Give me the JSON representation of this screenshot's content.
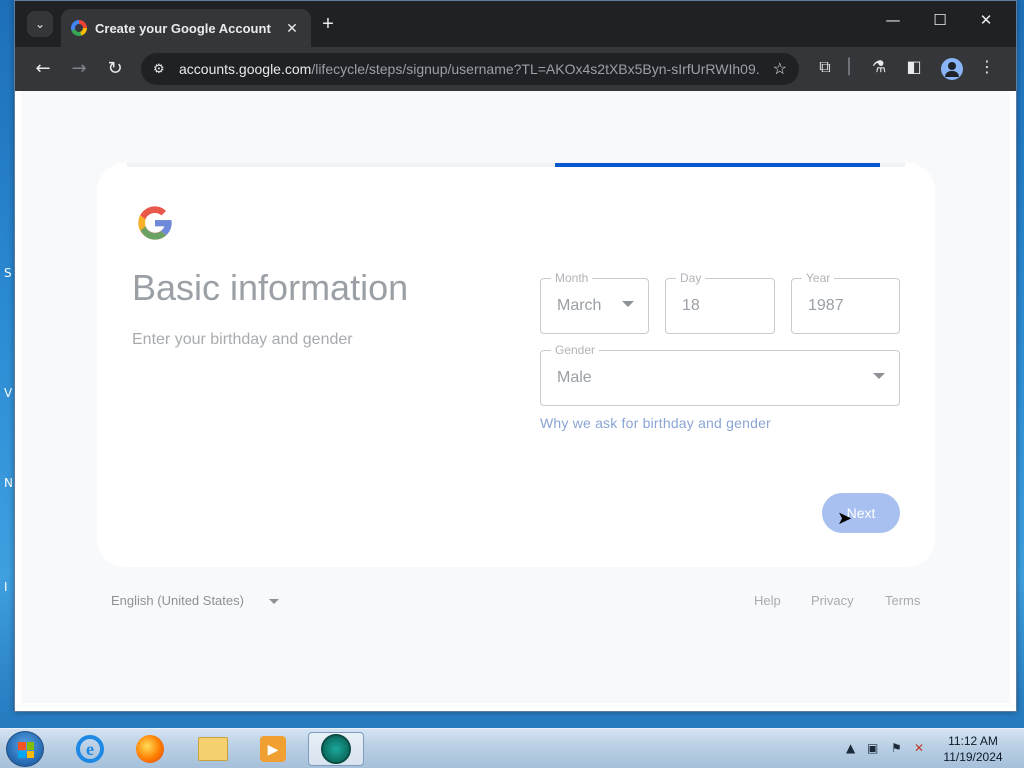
{
  "desktop": {
    "edge_glyphs": [
      "S",
      "V",
      "N",
      "I"
    ]
  },
  "browser": {
    "tab_title": "Create your Google Account",
    "url_host": "accounts.google.com",
    "url_path": "/lifecycle/steps/signup/username?TL=AKOx4s2tXBx5Byn-sIrfUrRWIh09...",
    "icons": {
      "tab_list": "chevron-down-icon",
      "tab_favicon": "google-icon",
      "tab_close": "close-icon",
      "new_tab": "plus-icon",
      "minimize": "minimize-icon",
      "maximize": "maximize-icon",
      "close_window": "close-icon",
      "back": "back-arrow-icon",
      "forward": "forward-arrow-icon",
      "reload": "reload-icon",
      "site_info": "tune-icon",
      "bookmark": "star-icon",
      "extensions": "puzzle-icon",
      "labs": "flask-icon",
      "side_panel": "side-panel-icon",
      "profile": "avatar-icon",
      "menu": "more-vert-icon"
    }
  },
  "signup": {
    "progress": 0.42,
    "heading": "Basic information",
    "subheading": "Enter your birthday and gender",
    "month": {
      "label": "Month",
      "value": "March"
    },
    "day": {
      "label": "Day",
      "value": "18"
    },
    "year": {
      "label": "Year",
      "value": "1987"
    },
    "gender": {
      "label": "Gender",
      "value": "Male"
    },
    "why_link": "Why we ask for birthday and gender",
    "next_label": "Next"
  },
  "footer": {
    "language": "English (United States)",
    "help": "Help",
    "privacy": "Privacy",
    "terms": "Terms"
  },
  "taskbar": {
    "apps": [
      "internet-explorer-icon",
      "firefox-icon",
      "file-explorer-icon",
      "media-player-icon",
      "browser-app-icon"
    ],
    "time": "11:12 AM",
    "date": "11/19/2024"
  },
  "colors": {
    "accent": "#0b57d0",
    "next_button": "#a8c0ef",
    "link": "#8aa4d6"
  }
}
